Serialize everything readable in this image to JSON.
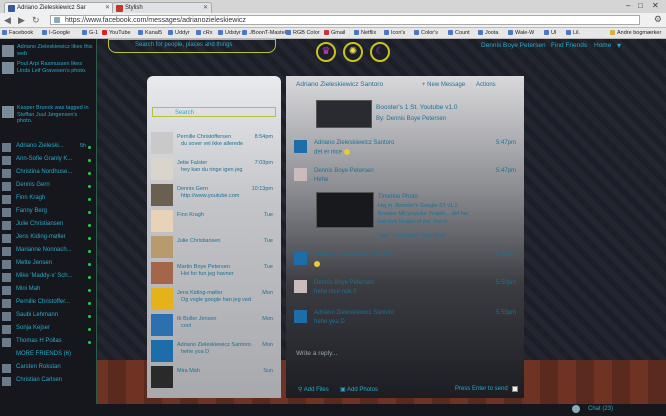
{
  "tabs": [
    {
      "title": "Adriano Zieleskiewicz Sar"
    },
    {
      "title": "Stylish"
    }
  ],
  "address": {
    "url": "https://www.facebook.com/messages/adrianozieleskiewicz"
  },
  "bookmarks": [
    "Facebook",
    "I-Google",
    "G-1",
    "YouTube",
    "Kanal5",
    "Uddyr",
    "cRx",
    "Udstyr",
    "./BoonT-MasteR",
    "RGB Color",
    "Gmail",
    "Netflix",
    "Icon's",
    "Color's",
    "Count",
    "Joota",
    "Wale-W",
    "UI",
    "Lil.",
    "Andre bogmærker"
  ],
  "sidebar": {
    "stories": [
      {
        "text": "Adriano Zieleskiewicz likes this web"
      },
      {
        "text": "Poul Arpi Rasmussen likes Linds Leif Gravesen's photo."
      },
      {
        "text": "Kasper Brunck was tagged in Steffan Juul Jørgensen's photo."
      }
    ],
    "friends": [
      {
        "name": "Adriano Zieleski...",
        "badge": "5h"
      },
      {
        "name": "Ann-Sofie Granly K..."
      },
      {
        "name": "Christina Nordhuse..."
      },
      {
        "name": "Dennis Gern"
      },
      {
        "name": "Finn Kragh"
      },
      {
        "name": "Fanny Berg"
      },
      {
        "name": "Julie Christiansen"
      },
      {
        "name": "Jens Kiding-møller"
      },
      {
        "name": "Marianne Nonnach..."
      },
      {
        "name": "Mette Jensen"
      },
      {
        "name": "Mike 'Maddy-x' Sch..."
      },
      {
        "name": "Mini Mah"
      },
      {
        "name": "Pernille Christoffer..."
      },
      {
        "name": "Saubi Lehmann"
      },
      {
        "name": "Sonja Kejser"
      },
      {
        "name": "Thomas H Pollas"
      },
      {
        "name": "MORE FRIENDS (6)"
      },
      {
        "name": "Carsten Rokstan"
      },
      {
        "name": "Christian Carlsen"
      }
    ]
  },
  "topbar": {
    "search_label": "Search for people, places and things",
    "profile_name": "Dennis Boye Petersen",
    "find_friends": "Find Friends",
    "home": "Home"
  },
  "message_list": {
    "search_label": "Search",
    "threads": [
      {
        "name": "Pernille Christoffersen",
        "time": "8:54pm",
        "preview": "du sover vel ikke allerede"
      },
      {
        "name": "Jette Falster",
        "time": "7:03pm",
        "preview": "hey kan du ringe igen jeg"
      },
      {
        "name": "Dennis Gern",
        "time": "10:13pm",
        "preview": "http://www.youtube.com"
      },
      {
        "name": "Finn Kragh",
        "time": "Tue",
        "preview": ""
      },
      {
        "name": "Julie Christiansen",
        "time": "Tue",
        "preview": ""
      },
      {
        "name": "Martin Boye Petersen",
        "time": "Tue",
        "preview": "Hei for fun jeg havner"
      },
      {
        "name": "Jens Kiding-møller",
        "time": "Mon",
        "preview": "Og vogle google han jeg ved"
      },
      {
        "name": "Ib Buller Jensen",
        "time": "Mon",
        "preview": "cool"
      },
      {
        "name": "Adriano Zieleskiewicz Santoro",
        "time": "Mon",
        "preview": "hehe yoa D"
      },
      {
        "name": "Mira Mah",
        "time": "Sun",
        "preview": ""
      }
    ]
  },
  "conversation": {
    "title": "Adriano Zieleskiewicz Santoro",
    "new_message": "+ New Message",
    "actions": "Actions",
    "attachment": {
      "title": "Booster's 1 St. Youtube v1.0",
      "by": "By: Dennis Boye Petersen"
    },
    "messages": [
      {
        "name": "Adriano Zieleskiewicz Santoro",
        "time": "5:47pm",
        "text": "det er nice"
      },
      {
        "name": "Dennis Boye Petersen",
        "time": "5:47pm",
        "text": "Hehe"
      },
      {
        "name": "",
        "time": "",
        "text": "Timeline Photo"
      },
      {
        "name": "Adriano Zieleskiewicz Santoro",
        "time": "5:49pm",
        "text": ""
      },
      {
        "name": "Dennis Boye Petersen",
        "time": "5:50pm",
        "text": "hehe nice nok 0"
      },
      {
        "name": "Adriano Zieleskiewicz Santoro",
        "time": "5:55pm",
        "text": "hehe yea D"
      }
    ],
    "timeline_lines": [
      "Hej m. Booster's Google ST v1.2",
      "Booster Mit youtube Projekt... det her",
      "kan nok bruges til det. Det er",
      "Like · Comment · See More"
    ],
    "reply_placeholder": "Write a reply...",
    "add_files": "Add Files",
    "add_photos": "Add Photos",
    "press_enter": "Press Enter to send"
  },
  "statusbar": {
    "chat": "Chat (23)"
  }
}
